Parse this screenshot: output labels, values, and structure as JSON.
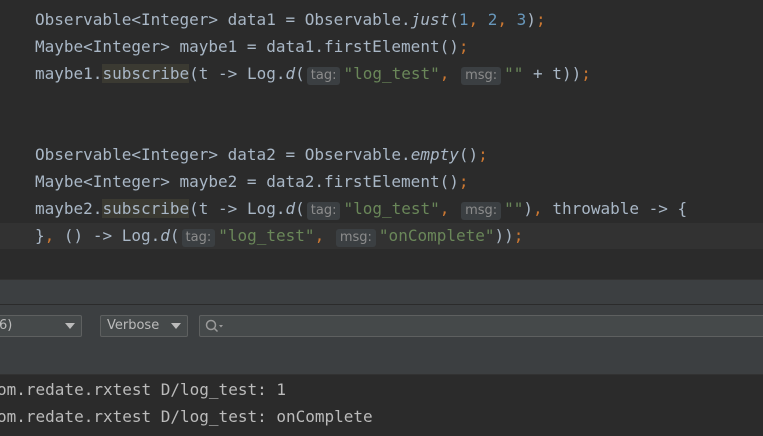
{
  "editor": {
    "l1": {
      "a": "Observable<Integer> data1 = Observable.",
      "b": "just",
      "c": "(",
      "n1": "1",
      "s1": ", ",
      "n2": "2",
      "s2": ", ",
      "n3": "3",
      "d": ")",
      "e": ";"
    },
    "l2": {
      "a": "Maybe<Integer> maybe1 = data1.firstElement()",
      "e": ";"
    },
    "l3": {
      "a": "maybe1.",
      "sub": "subscribe",
      "b": "(t -> Log.",
      "d": "d",
      "c": "(",
      "tag_hint": "tag:",
      "tag_val": "\"log_test\"",
      "comma": ",",
      "msg_hint": "msg:",
      "msg_val": "\"\"",
      "rest": " + t))",
      "e": ";"
    },
    "l4": {
      "a": "Observable<Integer> data2 = Observable.",
      "b": "empty",
      "c": "()",
      "e": ";"
    },
    "l5": {
      "a": "Maybe<Integer> maybe2 = data2.firstElement()",
      "e": ";"
    },
    "l6": {
      "a": "maybe2.",
      "sub": "subscribe",
      "b": "(t -> Log.",
      "d": "d",
      "c": "(",
      "tag_hint": "tag:",
      "tag_val": "\"log_test\"",
      "comma": ",",
      "msg_hint": "msg:",
      "msg_val": "\"\"",
      "rest1": ")",
      "comma2": ",",
      "rest2": " throwable -> {"
    },
    "l7": {
      "a": "}",
      "comma": ",",
      "b": " () -> Log.",
      "d": "d",
      "c": "(",
      "tag_hint": "tag:",
      "tag_val": "\"log_test\"",
      "comma2": ",",
      "msg_hint": "msg:",
      "msg_val": "\"onComplete\"",
      "rest": "))",
      "e": ";"
    }
  },
  "toolbar": {
    "device_combo_text": "6)",
    "level_combo_text": "Verbose",
    "search_icon": "search-icon"
  },
  "logcat": {
    "lines": [
      "om.redate.rxtest D/log_test: 1",
      "om.redate.rxtest D/log_test: onComplete"
    ]
  }
}
